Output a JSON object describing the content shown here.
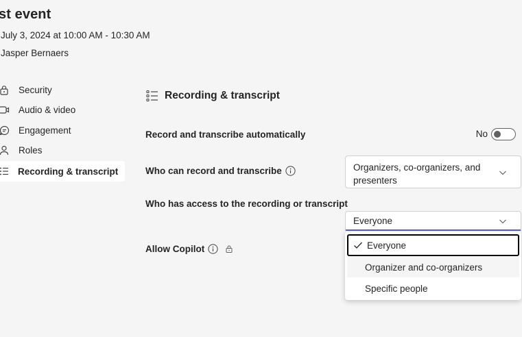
{
  "event": {
    "title": "st event",
    "datetime": "July 3, 2024 at 10:00 AM - 10:30 AM",
    "organizer": "Jasper Bernaers"
  },
  "sidebar": {
    "items": [
      {
        "label": "Security",
        "icon": "lock-icon"
      },
      {
        "label": "Audio & video",
        "icon": "video-icon"
      },
      {
        "label": "Engagement",
        "icon": "chat-icon"
      },
      {
        "label": "Roles",
        "icon": "person-icon"
      },
      {
        "label": "Recording & transcript",
        "icon": "list-icon",
        "active": true
      }
    ]
  },
  "main": {
    "section_title": "Recording & transcript",
    "record_auto": {
      "label": "Record and transcribe automatically",
      "toggle_text": "No",
      "on": false
    },
    "who_can_record": {
      "label": "Who can record and transcribe",
      "value": "Organizers, co-organizers, and presenters"
    },
    "who_has_access": {
      "label": "Who has access to the recording or transcript",
      "value": "Everyone"
    },
    "allow_copilot": {
      "label": "Allow Copilot"
    },
    "access_options": [
      {
        "label": "Everyone",
        "selected": true
      },
      {
        "label": "Organizer and co-organizers"
      },
      {
        "label": "Specific people"
      }
    ]
  },
  "colors": {
    "accent": "#5b5fc7",
    "background": "#f5f5f5",
    "text": "#242424"
  }
}
